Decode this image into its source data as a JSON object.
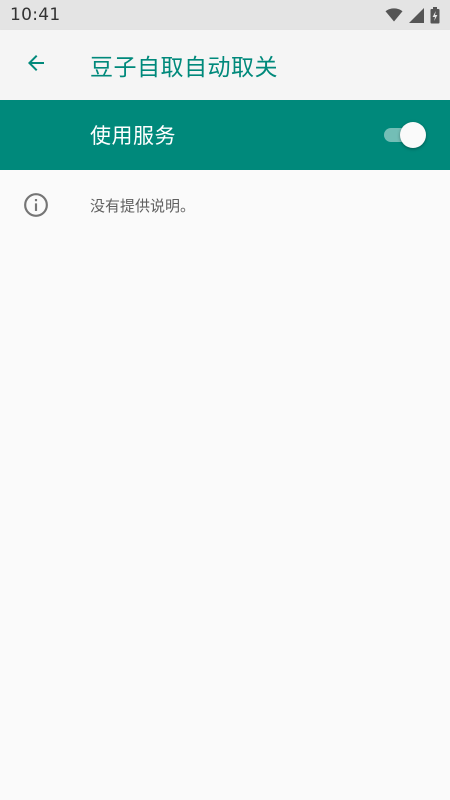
{
  "status_bar": {
    "time": "10:41",
    "icons": [
      "wifi-icon",
      "cellular-signal-icon",
      "battery-charging-icon"
    ]
  },
  "app_bar": {
    "back_icon": "arrow-left-icon",
    "title": "豆子自取自动取关"
  },
  "master_switch": {
    "label": "使用服务",
    "enabled": true
  },
  "info": {
    "icon": "info-icon",
    "text": "没有提供说明。"
  },
  "colors": {
    "primary": "#00897b",
    "status_bar_bg": "#e4e4e4",
    "app_bar_bg": "#f5f5f5",
    "background": "#fafafa",
    "secondary_text": "#5f5f5f"
  }
}
